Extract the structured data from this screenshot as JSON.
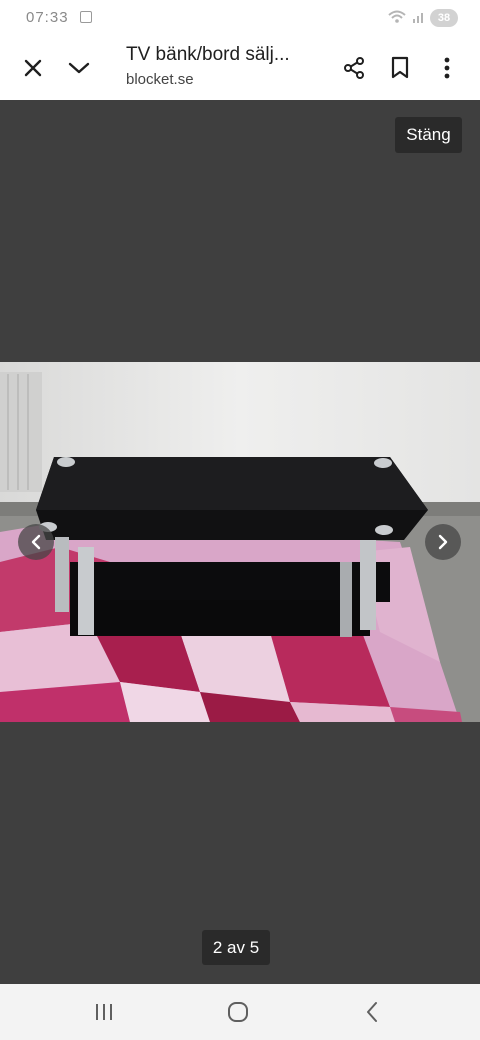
{
  "status_bar": {
    "time": "0​7:33",
    "battery": "38"
  },
  "toolbar": {
    "title": "TV bänk/bord sälj...",
    "domain": "blocket.se",
    "icons": [
      "close-icon",
      "chevron-down-icon",
      "share-icon",
      "bookmark-icon",
      "more-vert-icon"
    ]
  },
  "viewer": {
    "close_label": "Stäng",
    "counter": "2 av 5",
    "photo_description_icons": [
      "chevron-left-icon",
      "chevron-right-icon"
    ]
  },
  "nav_bar": {
    "icons": [
      "recent-apps-icon",
      "home-icon",
      "back-icon"
    ]
  },
  "colors": {
    "viewer_bg": "#3f3f3f",
    "overlay_button_bg": "#2a2a2a",
    "navbar_bg": "#f3f3f3"
  }
}
